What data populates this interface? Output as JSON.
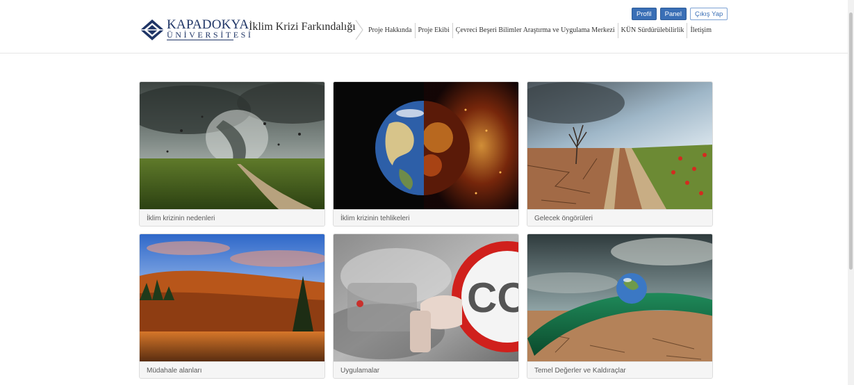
{
  "header": {
    "logo": {
      "name": "KAPADOKYA",
      "subtitle": "ÜNİVERSİTESİ"
    },
    "site_title": "İklim Krizi Farkındalığı",
    "nav": [
      {
        "label": "Proje Hakkında"
      },
      {
        "label": "Proje Ekibi"
      },
      {
        "label": "Çevreci Beşeri Bilimler Araştırma ve Uygulama Merkezi"
      },
      {
        "label": "KÜN Sürdürülebilirlik"
      },
      {
        "label": "İletişim"
      }
    ],
    "buttons": {
      "profile": "Profil",
      "panel": "Panel",
      "logout": "Çıkış Yap"
    }
  },
  "cards": [
    {
      "caption": "İklim krizinin nedenleri",
      "image": "tornado-storm-photo"
    },
    {
      "caption": "İklim krizinin tehlikeleri",
      "image": "burning-earth-photo"
    },
    {
      "caption": "Gelecek öngörüleri",
      "image": "dry-cracked-field-photo"
    },
    {
      "caption": "Müdahale alanları",
      "image": "autumn-forest-lake-photo"
    },
    {
      "caption": "Uygulamalar",
      "image": "co2-sign-photo"
    },
    {
      "caption": "Temel Değerler ve Kaldıraçlar",
      "image": "earth-drop-on-leaf-photo"
    }
  ],
  "colors": {
    "brand": "#1f3566",
    "primary_button": "#3a6fb6"
  }
}
